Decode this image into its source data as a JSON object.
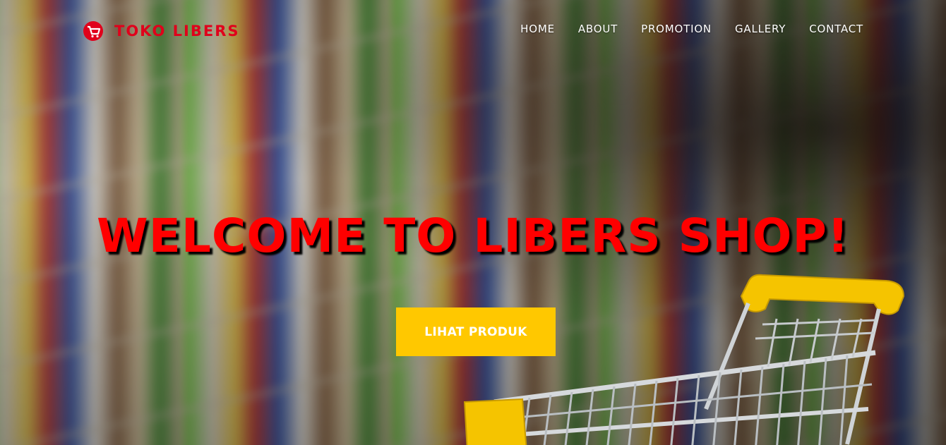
{
  "brand": {
    "name": "TOKO LIBERS",
    "logo_icon": "shopping-cart-logo-icon",
    "color": "#e0001b"
  },
  "nav": {
    "items": [
      {
        "label": "HOME"
      },
      {
        "label": "ABOUT"
      },
      {
        "label": "PROMOTION"
      },
      {
        "label": "GALLERY"
      },
      {
        "label": "CONTACT"
      }
    ]
  },
  "hero": {
    "headline": "WELCOME TO LIBERS SHOP!",
    "headline_color": "#ff0000",
    "cta_label": "LIHAT PRODUK",
    "cta_color": "#ffc800",
    "background": "blurred supermarket aisle with yellow shopping cart"
  }
}
